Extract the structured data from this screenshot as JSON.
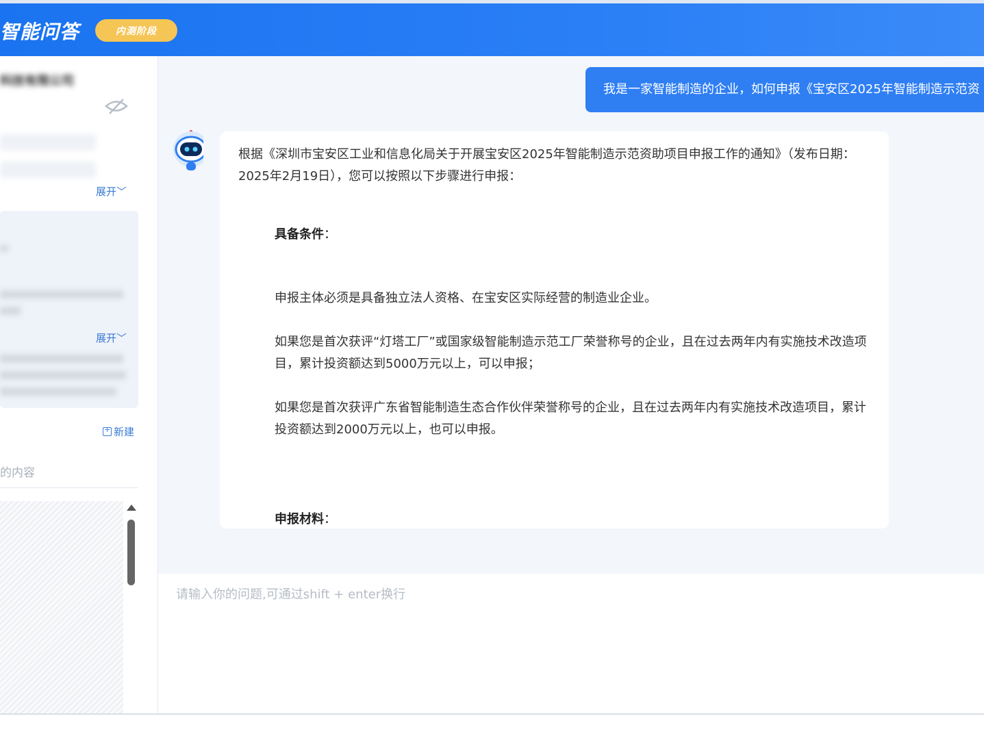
{
  "header": {
    "title": "智能问答",
    "stage_badge": "内测阶段"
  },
  "sidebar": {
    "company_name": "科技有限公司",
    "chips": [
      "",
      ""
    ],
    "expand_label_1": "展开",
    "expand_label_2": "展开",
    "new_button_label": "新建",
    "section_label": "的内容"
  },
  "chat": {
    "user_message": "我是一家智能制造的企业，如何申报《宝安区2025年智能制造示范资",
    "answer": {
      "intro": "根据《深圳市宝安区工业和信息化局关于开展宝安区2025年智能制造示范资助项目申报工作的通知》（发布日期：2025年2月19日），您可以按照以下步骤进行申报：",
      "heading_1": "具备条件",
      "heading_1_colon": "：",
      "para_1": "申报主体必须是具备独立法人资格、在宝安区实际经营的制造业企业。",
      "para_2": "如果您是首次获评“灯塔工厂”或国家级智能制造示范工厂荣誉称号的企业，且在过去两年内有实施技术改造项目，累计投资额达到5000万元以上，可以申报；",
      "para_3": "如果您是首次获评广东省智能制造生态合作伙伴荣誉称号的企业，且在过去两年内有实施技术改造项目，累计投资额达到2000万元以上，也可以申报。",
      "heading_2": "申报材料",
      "heading_2_colon": "："
    }
  },
  "input": {
    "placeholder": "请输入你的问题,可通过shift + enter换行"
  },
  "icons": {
    "hide": "eye-slash-icon",
    "bot": "robot-avatar-icon",
    "expand": "chevron-down-icon",
    "new": "plus-square-icon",
    "scroll": "scroll-up-arrow-icon"
  },
  "colors": {
    "header_blue": "#1a73f0",
    "badge_yellow": "#f5c556",
    "user_bubble": "#2f7ff3",
    "link_blue": "#3a7bd5"
  }
}
